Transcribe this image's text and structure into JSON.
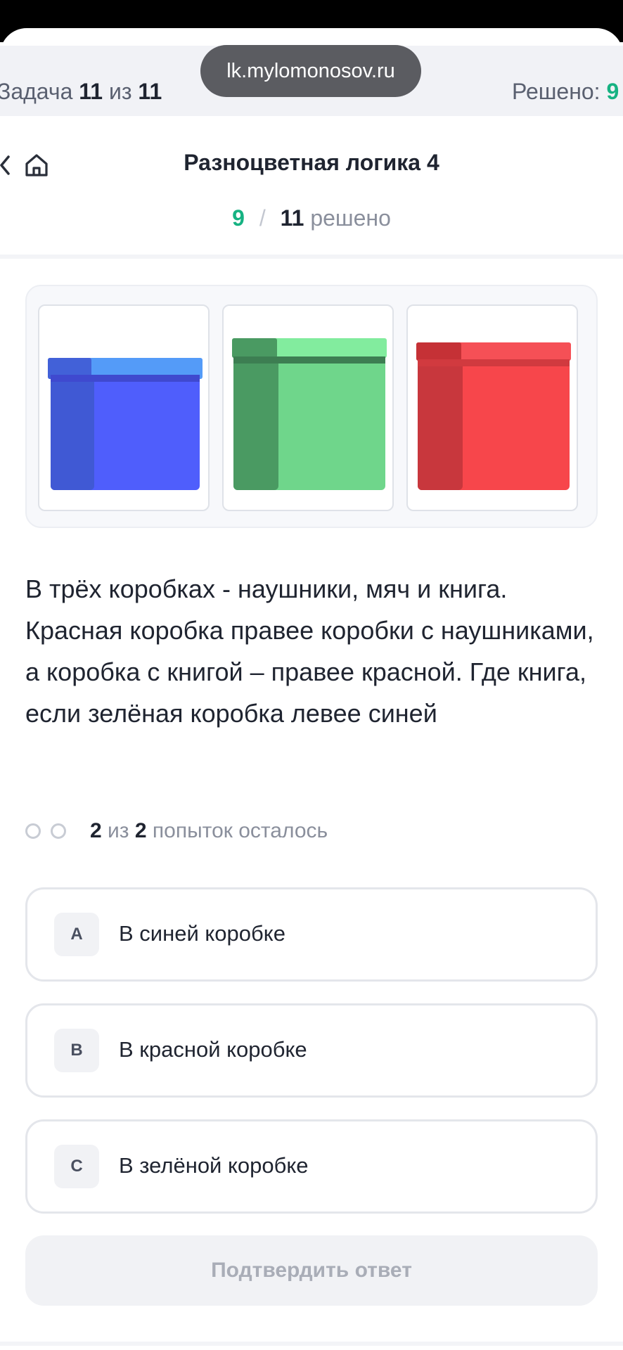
{
  "browser": {
    "url": "lk.mylomonosov.ru"
  },
  "task_bar": {
    "left_prefix": "Задача",
    "current": "11",
    "of": "из",
    "total": "11",
    "right_prefix": "Решено:",
    "solved": "9"
  },
  "header": {
    "title": "Разноцветная логика 4",
    "back_icon": "chevron-left-icon",
    "home_icon": "home-icon",
    "progress_solved": "9",
    "progress_sep": "/",
    "progress_total": "11",
    "progress_label": "решено"
  },
  "boxes": [
    {
      "color": "blue",
      "front": "#4f5efc",
      "front_side": "#4059d4",
      "lid": "#549bf8",
      "lid_side": "#4261d8"
    },
    {
      "color": "green",
      "front": "#6fd68b",
      "front_side": "#4a9a62",
      "lid": "#82ec9e",
      "lid_side": "#4a9a62"
    },
    {
      "color": "red",
      "front": "#f7464b",
      "front_side": "#c8373d",
      "lid": "#f55056",
      "lid_side": "#c53136"
    }
  ],
  "question": "В трёх коробках - наушники, мяч и книга. Красная коробка правее коробки с наушниками, а коробка с книгой – правее красной. Где книга, если зелёная коробка левее синей",
  "attempts": {
    "left": "2",
    "of": "из",
    "total": "2",
    "label": "попыток осталось"
  },
  "options": [
    {
      "letter": "A",
      "label": "В синей коробке"
    },
    {
      "letter": "B",
      "label": "В красной коробке"
    },
    {
      "letter": "C",
      "label": "В зелёной коробке"
    }
  ],
  "confirm_label": "Подтвердить ответ",
  "colors": {
    "accent_green": "#16b282",
    "text_dark": "#1f2430",
    "text_muted": "#8a8f9c"
  }
}
